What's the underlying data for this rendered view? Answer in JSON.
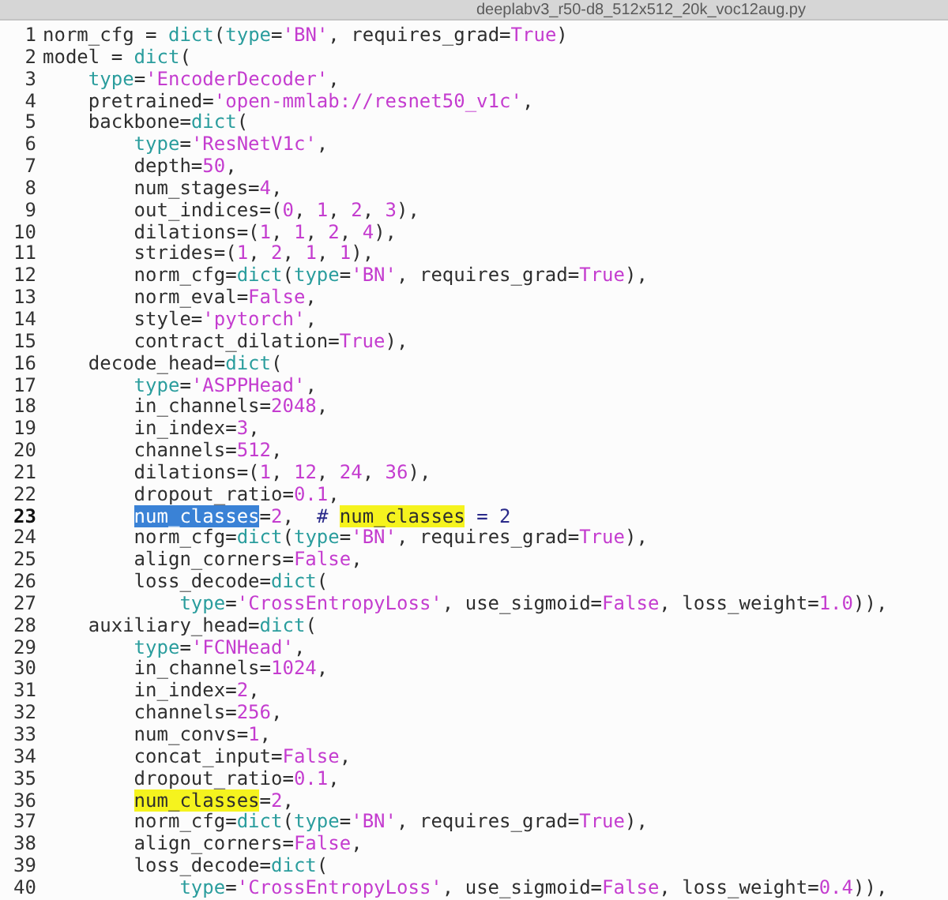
{
  "window": {
    "title": "deeplabv3_r50-d8_512x512_20k_voc12aug.py"
  },
  "lines": [
    {
      "number": "1",
      "current": false,
      "tokens": [
        {
          "kind": "plain",
          "text": "norm_cfg = "
        },
        {
          "kind": "builtin",
          "text": "dict"
        },
        {
          "kind": "plain",
          "text": "("
        },
        {
          "kind": "builtin",
          "text": "type"
        },
        {
          "kind": "plain",
          "text": "="
        },
        {
          "kind": "literal",
          "text": "'BN'"
        },
        {
          "kind": "plain",
          "text": ", requires_grad="
        },
        {
          "kind": "literal",
          "text": "True"
        },
        {
          "kind": "plain",
          "text": ")"
        }
      ]
    },
    {
      "number": "2",
      "current": false,
      "tokens": [
        {
          "kind": "plain",
          "text": "model = "
        },
        {
          "kind": "builtin",
          "text": "dict"
        },
        {
          "kind": "plain",
          "text": "("
        }
      ]
    },
    {
      "number": "3",
      "current": false,
      "tokens": [
        {
          "kind": "builtin",
          "text": "    type"
        },
        {
          "kind": "plain",
          "text": "="
        },
        {
          "kind": "literal",
          "text": "'EncoderDecoder'"
        },
        {
          "kind": "plain",
          "text": ","
        }
      ]
    },
    {
      "number": "4",
      "current": false,
      "tokens": [
        {
          "kind": "plain",
          "text": "    pretrained="
        },
        {
          "kind": "literal",
          "text": "'open-mmlab://resnet50_v1c'"
        },
        {
          "kind": "plain",
          "text": ","
        }
      ]
    },
    {
      "number": "5",
      "current": false,
      "tokens": [
        {
          "kind": "plain",
          "text": "    backbone="
        },
        {
          "kind": "builtin",
          "text": "dict"
        },
        {
          "kind": "plain",
          "text": "("
        }
      ]
    },
    {
      "number": "6",
      "current": false,
      "tokens": [
        {
          "kind": "builtin",
          "text": "        type"
        },
        {
          "kind": "plain",
          "text": "="
        },
        {
          "kind": "literal",
          "text": "'ResNetV1c'"
        },
        {
          "kind": "plain",
          "text": ","
        }
      ]
    },
    {
      "number": "7",
      "current": false,
      "tokens": [
        {
          "kind": "plain",
          "text": "        depth="
        },
        {
          "kind": "literal",
          "text": "50"
        },
        {
          "kind": "plain",
          "text": ","
        }
      ]
    },
    {
      "number": "8",
      "current": false,
      "tokens": [
        {
          "kind": "plain",
          "text": "        num_stages="
        },
        {
          "kind": "literal",
          "text": "4"
        },
        {
          "kind": "plain",
          "text": ","
        }
      ]
    },
    {
      "number": "9",
      "current": false,
      "tokens": [
        {
          "kind": "plain",
          "text": "        out_indices=("
        },
        {
          "kind": "literal",
          "text": "0"
        },
        {
          "kind": "plain",
          "text": ", "
        },
        {
          "kind": "literal",
          "text": "1"
        },
        {
          "kind": "plain",
          "text": ", "
        },
        {
          "kind": "literal",
          "text": "2"
        },
        {
          "kind": "plain",
          "text": ", "
        },
        {
          "kind": "literal",
          "text": "3"
        },
        {
          "kind": "plain",
          "text": "),"
        }
      ]
    },
    {
      "number": "10",
      "current": false,
      "tokens": [
        {
          "kind": "plain",
          "text": "        dilations=("
        },
        {
          "kind": "literal",
          "text": "1"
        },
        {
          "kind": "plain",
          "text": ", "
        },
        {
          "kind": "literal",
          "text": "1"
        },
        {
          "kind": "plain",
          "text": ", "
        },
        {
          "kind": "literal",
          "text": "2"
        },
        {
          "kind": "plain",
          "text": ", "
        },
        {
          "kind": "literal",
          "text": "4"
        },
        {
          "kind": "plain",
          "text": "),"
        }
      ]
    },
    {
      "number": "11",
      "current": false,
      "tokens": [
        {
          "kind": "plain",
          "text": "        strides=("
        },
        {
          "kind": "literal",
          "text": "1"
        },
        {
          "kind": "plain",
          "text": ", "
        },
        {
          "kind": "literal",
          "text": "2"
        },
        {
          "kind": "plain",
          "text": ", "
        },
        {
          "kind": "literal",
          "text": "1"
        },
        {
          "kind": "plain",
          "text": ", "
        },
        {
          "kind": "literal",
          "text": "1"
        },
        {
          "kind": "plain",
          "text": "),"
        }
      ]
    },
    {
      "number": "12",
      "current": false,
      "tokens": [
        {
          "kind": "plain",
          "text": "        norm_cfg="
        },
        {
          "kind": "builtin",
          "text": "dict"
        },
        {
          "kind": "plain",
          "text": "("
        },
        {
          "kind": "builtin",
          "text": "type"
        },
        {
          "kind": "plain",
          "text": "="
        },
        {
          "kind": "literal",
          "text": "'BN'"
        },
        {
          "kind": "plain",
          "text": ", requires_grad="
        },
        {
          "kind": "literal",
          "text": "True"
        },
        {
          "kind": "plain",
          "text": "),"
        }
      ]
    },
    {
      "number": "13",
      "current": false,
      "tokens": [
        {
          "kind": "plain",
          "text": "        norm_eval="
        },
        {
          "kind": "literal",
          "text": "False"
        },
        {
          "kind": "plain",
          "text": ","
        }
      ]
    },
    {
      "number": "14",
      "current": false,
      "tokens": [
        {
          "kind": "plain",
          "text": "        style="
        },
        {
          "kind": "literal",
          "text": "'pytorch'"
        },
        {
          "kind": "plain",
          "text": ","
        }
      ]
    },
    {
      "number": "15",
      "current": false,
      "tokens": [
        {
          "kind": "plain",
          "text": "        contract_dilation="
        },
        {
          "kind": "literal",
          "text": "True"
        },
        {
          "kind": "plain",
          "text": "),"
        }
      ]
    },
    {
      "number": "16",
      "current": false,
      "tokens": [
        {
          "kind": "plain",
          "text": "    decode_head="
        },
        {
          "kind": "builtin",
          "text": "dict"
        },
        {
          "kind": "plain",
          "text": "("
        }
      ]
    },
    {
      "number": "17",
      "current": false,
      "tokens": [
        {
          "kind": "builtin",
          "text": "        type"
        },
        {
          "kind": "plain",
          "text": "="
        },
        {
          "kind": "literal",
          "text": "'ASPPHead'"
        },
        {
          "kind": "plain",
          "text": ","
        }
      ]
    },
    {
      "number": "18",
      "current": false,
      "tokens": [
        {
          "kind": "plain",
          "text": "        in_channels="
        },
        {
          "kind": "literal",
          "text": "2048"
        },
        {
          "kind": "plain",
          "text": ","
        }
      ]
    },
    {
      "number": "19",
      "current": false,
      "tokens": [
        {
          "kind": "plain",
          "text": "        in_index="
        },
        {
          "kind": "literal",
          "text": "3"
        },
        {
          "kind": "plain",
          "text": ","
        }
      ]
    },
    {
      "number": "20",
      "current": false,
      "tokens": [
        {
          "kind": "plain",
          "text": "        channels="
        },
        {
          "kind": "literal",
          "text": "512"
        },
        {
          "kind": "plain",
          "text": ","
        }
      ]
    },
    {
      "number": "21",
      "current": false,
      "tokens": [
        {
          "kind": "plain",
          "text": "        dilations=("
        },
        {
          "kind": "literal",
          "text": "1"
        },
        {
          "kind": "plain",
          "text": ", "
        },
        {
          "kind": "literal",
          "text": "12"
        },
        {
          "kind": "plain",
          "text": ", "
        },
        {
          "kind": "literal",
          "text": "24"
        },
        {
          "kind": "plain",
          "text": ", "
        },
        {
          "kind": "literal",
          "text": "36"
        },
        {
          "kind": "plain",
          "text": "),"
        }
      ]
    },
    {
      "number": "22",
      "current": false,
      "tokens": [
        {
          "kind": "plain",
          "text": "        dropout_ratio="
        },
        {
          "kind": "literal",
          "text": "0.1"
        },
        {
          "kind": "plain",
          "text": ","
        }
      ]
    },
    {
      "number": "23",
      "current": true,
      "tokens": [
        {
          "kind": "selection",
          "text": "        num_classes"
        },
        {
          "kind": "plain",
          "text": "="
        },
        {
          "kind": "literal",
          "text": "2"
        },
        {
          "kind": "plain",
          "text": ",  "
        },
        {
          "kind": "comment",
          "text": "# "
        },
        {
          "kind": "match",
          "text": "num_classes"
        },
        {
          "kind": "comment",
          "text": " = 2"
        }
      ]
    },
    {
      "number": "24",
      "current": false,
      "tokens": [
        {
          "kind": "plain",
          "text": "        norm_cfg="
        },
        {
          "kind": "builtin",
          "text": "dict"
        },
        {
          "kind": "plain",
          "text": "("
        },
        {
          "kind": "builtin",
          "text": "type"
        },
        {
          "kind": "plain",
          "text": "="
        },
        {
          "kind": "literal",
          "text": "'BN'"
        },
        {
          "kind": "plain",
          "text": ", requires_grad="
        },
        {
          "kind": "literal",
          "text": "True"
        },
        {
          "kind": "plain",
          "text": "),"
        }
      ]
    },
    {
      "number": "25",
      "current": false,
      "tokens": [
        {
          "kind": "plain",
          "text": "        align_corners="
        },
        {
          "kind": "literal",
          "text": "False"
        },
        {
          "kind": "plain",
          "text": ","
        }
      ]
    },
    {
      "number": "26",
      "current": false,
      "tokens": [
        {
          "kind": "plain",
          "text": "        loss_decode="
        },
        {
          "kind": "builtin",
          "text": "dict"
        },
        {
          "kind": "plain",
          "text": "("
        }
      ]
    },
    {
      "number": "27",
      "current": false,
      "tokens": [
        {
          "kind": "builtin",
          "text": "            type"
        },
        {
          "kind": "plain",
          "text": "="
        },
        {
          "kind": "literal",
          "text": "'CrossEntropyLoss'"
        },
        {
          "kind": "plain",
          "text": ", use_sigmoid="
        },
        {
          "kind": "literal",
          "text": "False"
        },
        {
          "kind": "plain",
          "text": ", loss_weight="
        },
        {
          "kind": "literal",
          "text": "1.0"
        },
        {
          "kind": "plain",
          "text": ")),"
        }
      ]
    },
    {
      "number": "28",
      "current": false,
      "tokens": [
        {
          "kind": "plain",
          "text": "    auxiliary_head="
        },
        {
          "kind": "builtin",
          "text": "dict"
        },
        {
          "kind": "plain",
          "text": "("
        }
      ]
    },
    {
      "number": "29",
      "current": false,
      "tokens": [
        {
          "kind": "builtin",
          "text": "        type"
        },
        {
          "kind": "plain",
          "text": "="
        },
        {
          "kind": "literal",
          "text": "'FCNHead'"
        },
        {
          "kind": "plain",
          "text": ","
        }
      ]
    },
    {
      "number": "30",
      "current": false,
      "tokens": [
        {
          "kind": "plain",
          "text": "        in_channels="
        },
        {
          "kind": "literal",
          "text": "1024"
        },
        {
          "kind": "plain",
          "text": ","
        }
      ]
    },
    {
      "number": "31",
      "current": false,
      "tokens": [
        {
          "kind": "plain",
          "text": "        in_index="
        },
        {
          "kind": "literal",
          "text": "2"
        },
        {
          "kind": "plain",
          "text": ","
        }
      ]
    },
    {
      "number": "32",
      "current": false,
      "tokens": [
        {
          "kind": "plain",
          "text": "        channels="
        },
        {
          "kind": "literal",
          "text": "256"
        },
        {
          "kind": "plain",
          "text": ","
        }
      ]
    },
    {
      "number": "33",
      "current": false,
      "tokens": [
        {
          "kind": "plain",
          "text": "        num_convs="
        },
        {
          "kind": "literal",
          "text": "1"
        },
        {
          "kind": "plain",
          "text": ","
        }
      ]
    },
    {
      "number": "34",
      "current": false,
      "tokens": [
        {
          "kind": "plain",
          "text": "        concat_input="
        },
        {
          "kind": "literal",
          "text": "False"
        },
        {
          "kind": "plain",
          "text": ","
        }
      ]
    },
    {
      "number": "35",
      "current": false,
      "tokens": [
        {
          "kind": "plain",
          "text": "        dropout_ratio="
        },
        {
          "kind": "literal",
          "text": "0.1"
        },
        {
          "kind": "plain",
          "text": ","
        }
      ]
    },
    {
      "number": "36",
      "current": false,
      "tokens": [
        {
          "kind": "match",
          "text": "        num_classes"
        },
        {
          "kind": "plain",
          "text": "="
        },
        {
          "kind": "literal",
          "text": "2"
        },
        {
          "kind": "plain",
          "text": ","
        }
      ]
    },
    {
      "number": "37",
      "current": false,
      "tokens": [
        {
          "kind": "plain",
          "text": "        norm_cfg="
        },
        {
          "kind": "builtin",
          "text": "dict"
        },
        {
          "kind": "plain",
          "text": "("
        },
        {
          "kind": "builtin",
          "text": "type"
        },
        {
          "kind": "plain",
          "text": "="
        },
        {
          "kind": "literal",
          "text": "'BN'"
        },
        {
          "kind": "plain",
          "text": ", requires_grad="
        },
        {
          "kind": "literal",
          "text": "True"
        },
        {
          "kind": "plain",
          "text": "),"
        }
      ]
    },
    {
      "number": "38",
      "current": false,
      "tokens": [
        {
          "kind": "plain",
          "text": "        align_corners="
        },
        {
          "kind": "literal",
          "text": "False"
        },
        {
          "kind": "plain",
          "text": ","
        }
      ]
    },
    {
      "number": "39",
      "current": false,
      "tokens": [
        {
          "kind": "plain",
          "text": "        loss_decode="
        },
        {
          "kind": "builtin",
          "text": "dict"
        },
        {
          "kind": "plain",
          "text": "("
        }
      ]
    },
    {
      "number": "40",
      "current": false,
      "tokens": [
        {
          "kind": "builtin",
          "text": "            type"
        },
        {
          "kind": "plain",
          "text": "="
        },
        {
          "kind": "literal",
          "text": "'CrossEntropyLoss'"
        },
        {
          "kind": "plain",
          "text": ", use_sigmoid="
        },
        {
          "kind": "literal",
          "text": "False"
        },
        {
          "kind": "plain",
          "text": ", loss_weight="
        },
        {
          "kind": "literal",
          "text": "0.4"
        },
        {
          "kind": "plain",
          "text": ")),"
        }
      ]
    }
  ]
}
